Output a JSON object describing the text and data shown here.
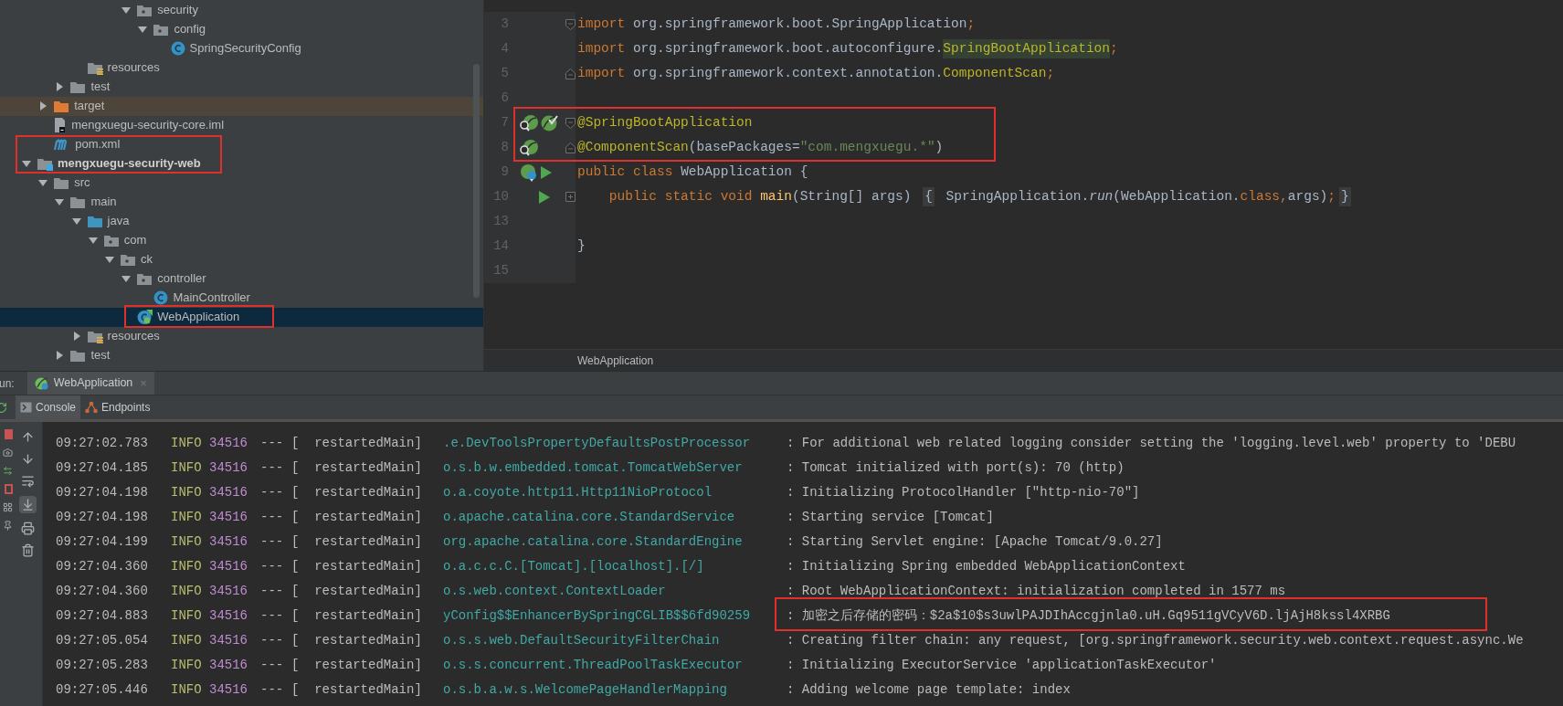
{
  "project_tree": {
    "items": [
      {
        "label": "security",
        "kind": "package",
        "expanded": true,
        "selected": false,
        "children": [
          {
            "label": "config",
            "kind": "package",
            "expanded": true,
            "selected": false,
            "children": [
              {
                "label": "SpringSecurityConfig",
                "kind": "class",
                "selected": false
              }
            ]
          }
        ]
      },
      {
        "label": "resources",
        "kind": "resource-folder",
        "selected": false
      },
      {
        "label": "test",
        "kind": "folder",
        "expanded": false,
        "selected": false
      },
      {
        "label": "target",
        "kind": "excluded-folder",
        "expanded": false,
        "selected": false
      },
      {
        "label": "mengxuegu-security-core.iml",
        "kind": "iml",
        "selected": false
      },
      {
        "label": "pom.xml",
        "kind": "maven",
        "selected": false
      },
      {
        "label": "mengxuegu-security-web",
        "kind": "module",
        "expanded": true,
        "selected": false,
        "children": [
          {
            "label": "src",
            "kind": "folder",
            "expanded": true,
            "selected": false,
            "children": [
              {
                "label": "main",
                "kind": "folder",
                "expanded": true,
                "selected": false,
                "children": [
                  {
                    "label": "java",
                    "kind": "source-folder",
                    "expanded": true,
                    "selected": false,
                    "children": [
                      {
                        "label": "com",
                        "kind": "package",
                        "expanded": true,
                        "selected": false,
                        "children": [
                          {
                            "label": "ck",
                            "kind": "package",
                            "expanded": true,
                            "selected": false,
                            "children": [
                              {
                                "label": "controller",
                                "kind": "package",
                                "expanded": true,
                                "selected": false,
                                "children": [
                                  {
                                    "label": "MainController",
                                    "kind": "class",
                                    "selected": false
                                  }
                                ]
                              },
                              {
                                "label": "WebApplication",
                                "kind": "spring-class",
                                "selected": true
                              }
                            ]
                          }
                        ]
                      }
                    ]
                  },
                  {
                    "label": "resources",
                    "kind": "resource-folder",
                    "expanded": false,
                    "selected": false
                  }
                ]
              },
              {
                "label": "test",
                "kind": "folder",
                "expanded": false,
                "selected": false
              }
            ]
          }
        ]
      }
    ]
  },
  "editor": {
    "lines": [
      {
        "number": "3",
        "fold_marker": {
          "kind": "start"
        },
        "tokens": [
          {
            "text": "import",
            "kind": "keyword"
          },
          {
            "text": " org.springframework.boot.SpringApplication",
            "kind": "plain"
          },
          {
            "text": ";",
            "kind": "keyword"
          }
        ]
      },
      {
        "number": "4",
        "tokens": [
          {
            "text": "import",
            "kind": "keyword"
          },
          {
            "text": " org.springframework.boot.autoconfigure.",
            "kind": "plain"
          },
          {
            "text": "SpringBootApplication",
            "kind": "marked-ref"
          },
          {
            "text": ";",
            "kind": "keyword"
          }
        ]
      },
      {
        "number": "5",
        "fold_marker": {
          "kind": "end"
        },
        "tokens": [
          {
            "text": "import",
            "kind": "keyword"
          },
          {
            "text": " org.springframework.context.annotation.",
            "kind": "plain"
          },
          {
            "text": "ComponentScan",
            "kind": "annotation"
          },
          {
            "text": ";",
            "kind": "keyword"
          }
        ]
      },
      {
        "number": "6"
      },
      {
        "number": "7",
        "fold_marker": {
          "kind": "start"
        },
        "gutter": [
          {
            "kind": "bean"
          },
          {
            "kind": "bean-check"
          }
        ],
        "tokens": [
          {
            "text": "@SpringBootApplication",
            "kind": "annotation"
          }
        ]
      },
      {
        "number": "8",
        "fold_marker": {
          "kind": "end"
        },
        "gutter": [
          {
            "kind": "bean"
          }
        ],
        "tokens": [
          {
            "text": "@ComponentScan",
            "kind": "annotation"
          },
          {
            "text": "(basePackages=",
            "kind": "plain"
          },
          {
            "text": "\"com.mengxuegu.*\"",
            "kind": "string"
          },
          {
            "text": ")",
            "kind": "plain"
          }
        ]
      },
      {
        "number": "9",
        "gutter": [
          {
            "kind": "bean-run"
          },
          {
            "kind": "run"
          }
        ],
        "tokens": [
          {
            "text": "public class ",
            "kind": "keyword"
          },
          {
            "text": "WebApplication {",
            "kind": "plain"
          }
        ]
      },
      {
        "number": "10",
        "fold_marker": {
          "kind": "collapsed"
        },
        "gutter": [
          {
            "kind": "spacer"
          },
          {
            "kind": "run"
          }
        ],
        "tokens": [
          {
            "text": "    public static void ",
            "kind": "keyword"
          },
          {
            "text": "main",
            "kind": "method"
          },
          {
            "text": "(String[] args) ",
            "kind": "plain"
          },
          {
            "text": "{",
            "kind": "fold-brace"
          },
          {
            "text": " SpringApplication.",
            "kind": "plain"
          },
          {
            "text": "run",
            "kind": "static-call"
          },
          {
            "text": "(WebApplication.",
            "kind": "plain"
          },
          {
            "text": "class",
            "kind": "keyword"
          },
          {
            "text": ",",
            "kind": "keyword"
          },
          {
            "text": "args)",
            "kind": "plain"
          },
          {
            "text": ";",
            "kind": "keyword"
          },
          {
            "text": "}",
            "kind": "fold-brace"
          }
        ]
      },
      {
        "number": "13"
      },
      {
        "number": "14",
        "tokens": [
          {
            "text": "}",
            "kind": "plain"
          }
        ]
      },
      {
        "number": "15"
      }
    ],
    "breadcrumb": "WebApplication"
  },
  "run_panel": {
    "label": "un:",
    "tab": "WebApplication",
    "close": "×",
    "tabs": [
      {
        "label": "Console",
        "selected": true
      },
      {
        "label": "Endpoints",
        "selected": false
      }
    ],
    "rows": [
      {
        "time": "09:27:02.783",
        "level": "INFO",
        "pid": "34516",
        "sep": "---",
        "thread": "[  restartedMain]",
        "logger": ".e.DevToolsPropertyDefaultsPostProcessor",
        "message": ": For additional web related logging consider setting the 'logging.level.web' property to 'DEBU"
      },
      {
        "time": "09:27:04.185",
        "level": "INFO",
        "pid": "34516",
        "sep": "---",
        "thread": "[  restartedMain]",
        "logger": "o.s.b.w.embedded.tomcat.TomcatWebServer",
        "message": ": Tomcat initialized with port(s): 70 (http)"
      },
      {
        "time": "09:27:04.198",
        "level": "INFO",
        "pid": "34516",
        "sep": "---",
        "thread": "[  restartedMain]",
        "logger": "o.a.coyote.http11.Http11NioProtocol",
        "message": ": Initializing ProtocolHandler [\"http-nio-70\"]"
      },
      {
        "time": "09:27:04.198",
        "level": "INFO",
        "pid": "34516",
        "sep": "---",
        "thread": "[  restartedMain]",
        "logger": "o.apache.catalina.core.StandardService",
        "message": ": Starting service [Tomcat]"
      },
      {
        "time": "09:27:04.199",
        "level": "INFO",
        "pid": "34516",
        "sep": "---",
        "thread": "[  restartedMain]",
        "logger": "org.apache.catalina.core.StandardEngine",
        "message": ": Starting Servlet engine: [Apache Tomcat/9.0.27]"
      },
      {
        "time": "09:27:04.360",
        "level": "INFO",
        "pid": "34516",
        "sep": "---",
        "thread": "[  restartedMain]",
        "logger": "o.a.c.c.C.[Tomcat].[localhost].[/]",
        "message": ": Initializing Spring embedded WebApplicationContext"
      },
      {
        "time": "09:27:04.360",
        "level": "INFO",
        "pid": "34516",
        "sep": "---",
        "thread": "[  restartedMain]",
        "logger": "o.s.web.context.ContextLoader",
        "message": ": Root WebApplicationContext: initialization completed in 1577 ms"
      },
      {
        "time": "09:27:04.883",
        "level": "INFO",
        "pid": "34516",
        "sep": "---",
        "thread": "[  restartedMain]",
        "logger": "yConfig$$EnhancerBySpringCGLIB$$6fd90259",
        "message": ": 加密之后存储的密码：$2a$10$s3uwlPAJDIhAccgjnla0.uH.Gq9511gVCyV6D.ljAjH8kssl4XRBG"
      },
      {
        "time": "09:27:05.054",
        "level": "INFO",
        "pid": "34516",
        "sep": "---",
        "thread": "[  restartedMain]",
        "logger": "o.s.s.web.DefaultSecurityFilterChain",
        "message": ": Creating filter chain: any request, [org.springframework.security.web.context.request.async.We"
      },
      {
        "time": "09:27:05.283",
        "level": "INFO",
        "pid": "34516",
        "sep": "---",
        "thread": "[  restartedMain]",
        "logger": "o.s.s.concurrent.ThreadPoolTaskExecutor",
        "message": ": Initializing ExecutorService 'applicationTaskExecutor'"
      },
      {
        "time": "09:27:05.446",
        "level": "INFO",
        "pid": "34516",
        "sep": "---",
        "thread": "[  restartedMain]",
        "logger": "o.s.b.a.w.s.WelcomePageHandlerMapping",
        "message": ": Adding welcome page template: index"
      }
    ]
  }
}
